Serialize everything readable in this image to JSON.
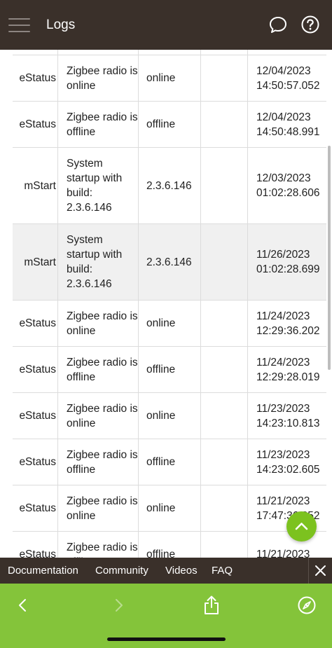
{
  "header": {
    "title": "Logs",
    "icons": [
      "menu-icon",
      "chat-bubble-icon",
      "help-icon"
    ]
  },
  "log_table": {
    "rows": [
      {
        "type": "",
        "message": "",
        "value": "",
        "extra": "",
        "time": ""
      },
      {
        "type": "eStatus",
        "message": "Zigbee radio is online",
        "value": "online",
        "extra": "",
        "time": "12/04/2023 14:50:57.052"
      },
      {
        "type": "eStatus",
        "message": "Zigbee radio is offline",
        "value": "offline",
        "extra": "",
        "time": "12/04/2023 14:50:48.991"
      },
      {
        "type": "mStart",
        "message": "System startup with build: 2.3.6.146",
        "value": "2.3.6.146",
        "extra": "",
        "time": "12/03/2023 01:02:28.606"
      },
      {
        "type": "mStart",
        "message": "System startup with build: 2.3.6.146",
        "value": "2.3.6.146",
        "extra": "",
        "time": "11/26/2023 01:02:28.699"
      },
      {
        "type": "eStatus",
        "message": "Zigbee radio is online",
        "value": "online",
        "extra": "",
        "time": "11/24/2023 12:29:36.202"
      },
      {
        "type": "eStatus",
        "message": "Zigbee radio is offline",
        "value": "offline",
        "extra": "",
        "time": "11/24/2023 12:29:28.019"
      },
      {
        "type": "eStatus",
        "message": "Zigbee radio is online",
        "value": "online",
        "extra": "",
        "time": "11/23/2023 14:23:10.813"
      },
      {
        "type": "eStatus",
        "message": "Zigbee radio is offline",
        "value": "offline",
        "extra": "",
        "time": "11/23/2023 14:23:02.605"
      },
      {
        "type": "eStatus",
        "message": "Zigbee radio is online",
        "value": "online",
        "extra": "",
        "time": "11/21/2023 17:47:36.252"
      },
      {
        "type": "eStatus",
        "message": "Zigbee radio is offline",
        "value": "offline",
        "extra": "",
        "time": "11/21/2023"
      }
    ]
  },
  "footer_links": {
    "documentation": "Documentation",
    "community": "Community",
    "videos": "Videos",
    "faq": "FAQ"
  },
  "browser_bar": {
    "icons": [
      "back-icon",
      "forward-icon",
      "share-icon",
      "compass-icon"
    ]
  },
  "colors": {
    "header_bg": "#3a302a",
    "accent_green": "#7cc21f",
    "browser_bar_bg": "#84c43a",
    "row_highlight": "#f0f0f0"
  }
}
